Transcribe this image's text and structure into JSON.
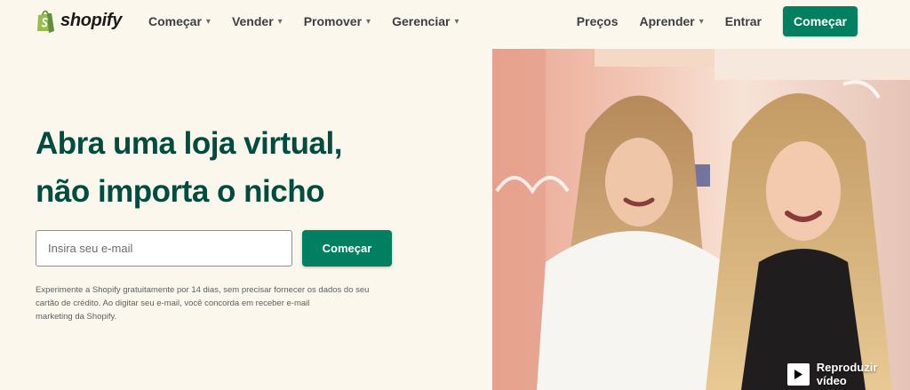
{
  "nav": {
    "logo_text": "shopify",
    "menu": [
      {
        "label": "Começar"
      },
      {
        "label": "Vender"
      },
      {
        "label": "Promover"
      },
      {
        "label": "Gerenciar"
      }
    ],
    "right": {
      "pricing": "Preços",
      "learn": "Aprender",
      "login": "Entrar",
      "cta": "Começar"
    },
    "chevron": "⌄"
  },
  "hero": {
    "headline_line1": "Abra uma loja virtual,",
    "headline_line2": "não importa o nicho",
    "email_placeholder": "Insira seu e-mail",
    "email_value": "",
    "cta": "Começar",
    "disclaimer_line1": "Experimente a Shopify gratuitamente por 14 dias, sem precisar fornecer os dados do seu",
    "disclaimer_line2": "cartão de crédito. Ao digitar seu e-mail, você concorda em receber e-mail",
    "disclaimer_line3": "marketing da Shopify.",
    "video_label": "Reproduzir vídeo",
    "icons": {
      "play": "play-icon",
      "logo": "shopify-bag-icon"
    }
  },
  "colors": {
    "background": "#fbf7ed",
    "brand_green": "#008060",
    "headline_green": "#004c3f",
    "logo_green": "#95bf47"
  }
}
